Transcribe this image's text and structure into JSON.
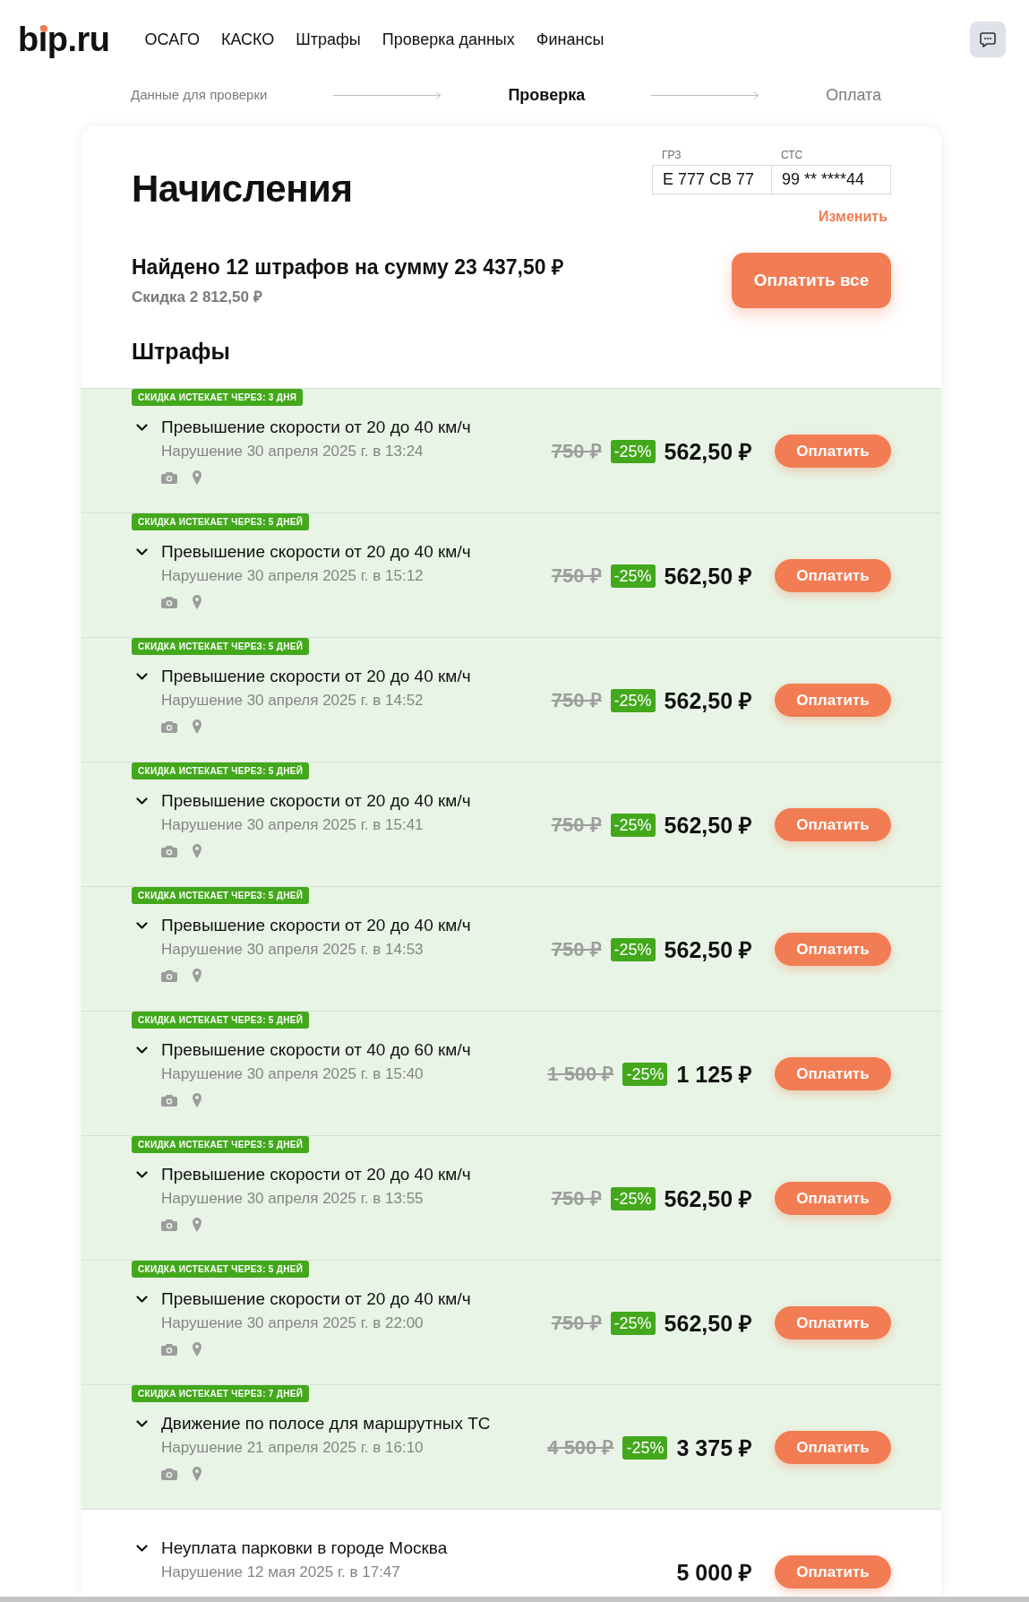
{
  "header": {
    "logo": "bip.ru",
    "nav": [
      {
        "label": "ОСАГО"
      },
      {
        "label": "КАСКО"
      },
      {
        "label": "Штрафы"
      },
      {
        "label": "Проверка данных"
      },
      {
        "label": "Финансы"
      }
    ]
  },
  "stepper": [
    {
      "label": "Данные для проверки",
      "completed": true,
      "selected": false
    },
    {
      "label": "Проверка",
      "completed": false,
      "selected": true
    },
    {
      "label": "Оплата",
      "completed": false,
      "selected": false
    }
  ],
  "charges": {
    "title": "Начисления",
    "vehicle_fields": [
      {
        "label": "ГРЗ",
        "value": "Е 777 СВ 77"
      },
      {
        "label": "СТС",
        "value": "99 ** ****44"
      }
    ],
    "change_link": "Изменить",
    "summary": "Найдено 12 штрафов на сумму 23 437,50 ₽",
    "discount": "Скидка 2 812,50 ₽",
    "pay_all_button": "Оплатить все",
    "section_title": "Штрафы"
  },
  "fines": [
    {
      "kind": "discounted",
      "badge": "СКИДКА ИСТЕКАЕТ ЧЕРЕЗ: 3 ДНЯ",
      "title": "Превышение скорости от 20 до 40 км/ч",
      "date": "Нарушение 30 апреля 2025 г. в 13:24",
      "icons_visible": true,
      "old_price": "750 ₽",
      "discount": "-25%",
      "price": "562,50 ₽",
      "pay_button": "Оплатить"
    },
    {
      "kind": "discounted",
      "badge": "СКИДКА ИСТЕКАЕТ ЧЕРЕЗ: 5 ДНЕЙ",
      "title": "Превышение скорости от 20 до 40 км/ч",
      "date": "Нарушение 30 апреля 2025 г. в 15:12",
      "icons_visible": true,
      "old_price": "750 ₽",
      "discount": "-25%",
      "price": "562,50 ₽",
      "pay_button": "Оплатить"
    },
    {
      "kind": "discounted",
      "badge": "СКИДКА ИСТЕКАЕТ ЧЕРЕЗ: 5 ДНЕЙ",
      "title": "Превышение скорости от 20 до 40 км/ч",
      "date": "Нарушение 30 апреля 2025 г. в 14:52",
      "icons_visible": true,
      "old_price": "750 ₽",
      "discount": "-25%",
      "price": "562,50 ₽",
      "pay_button": "Оплатить"
    },
    {
      "kind": "discounted",
      "badge": "СКИДКА ИСТЕКАЕТ ЧЕРЕЗ: 5 ДНЕЙ",
      "title": "Превышение скорости от 20 до 40 км/ч",
      "date": "Нарушение 30 апреля 2025 г. в 15:41",
      "icons_visible": true,
      "old_price": "750 ₽",
      "discount": "-25%",
      "price": "562,50 ₽",
      "pay_button": "Оплатить"
    },
    {
      "kind": "discounted",
      "badge": "СКИДКА ИСТЕКАЕТ ЧЕРЕЗ: 5 ДНЕЙ",
      "title": "Превышение скорости от 20 до 40 км/ч",
      "date": "Нарушение 30 апреля 2025 г. в 14:53",
      "icons_visible": true,
      "old_price": "750 ₽",
      "discount": "-25%",
      "price": "562,50 ₽",
      "pay_button": "Оплатить"
    },
    {
      "kind": "discounted",
      "badge": "СКИДКА ИСТЕКАЕТ ЧЕРЕЗ: 5 ДНЕЙ",
      "title": "Превышение скорости от 40 до 60 км/ч",
      "date": "Нарушение 30 апреля 2025 г. в 15:40",
      "icons_visible": true,
      "old_price": "1 500 ₽",
      "discount": "-25%",
      "price": "1 125 ₽",
      "pay_button": "Оплатить"
    },
    {
      "kind": "discounted",
      "badge": "СКИДКА ИСТЕКАЕТ ЧЕРЕЗ: 5 ДНЕЙ",
      "title": "Превышение скорости от 20 до 40 км/ч",
      "date": "Нарушение 30 апреля 2025 г. в 13:55",
      "icons_visible": true,
      "old_price": "750 ₽",
      "discount": "-25%",
      "price": "562,50 ₽",
      "pay_button": "Оплатить"
    },
    {
      "kind": "discounted",
      "badge": "СКИДКА ИСТЕКАЕТ ЧЕРЕЗ: 5 ДНЕЙ",
      "title": "Превышение скорости от 20 до 40 км/ч",
      "date": "Нарушение 30 апреля 2025 г. в 22:00",
      "icons_visible": true,
      "old_price": "750 ₽",
      "discount": "-25%",
      "price": "562,50 ₽",
      "pay_button": "Оплатить"
    },
    {
      "kind": "discounted",
      "badge": "СКИДКА ИСТЕКАЕТ ЧЕРЕЗ: 7 ДНЕЙ",
      "title": "Движение по полосе для маршрутных ТС",
      "date": "Нарушение 21 апреля 2025 г. в 16:10",
      "icons_visible": true,
      "old_price": "4 500 ₽",
      "discount": "-25%",
      "price": "3 375 ₽",
      "pay_button": "Оплатить"
    },
    {
      "kind": "regular",
      "title": "Неуплата парковки в городе Москва",
      "date": "Нарушение 12 мая 2025 г. в 17:47",
      "icons_visible": false,
      "price": "5 000 ₽",
      "pay_button": "Оплатить"
    }
  ]
}
